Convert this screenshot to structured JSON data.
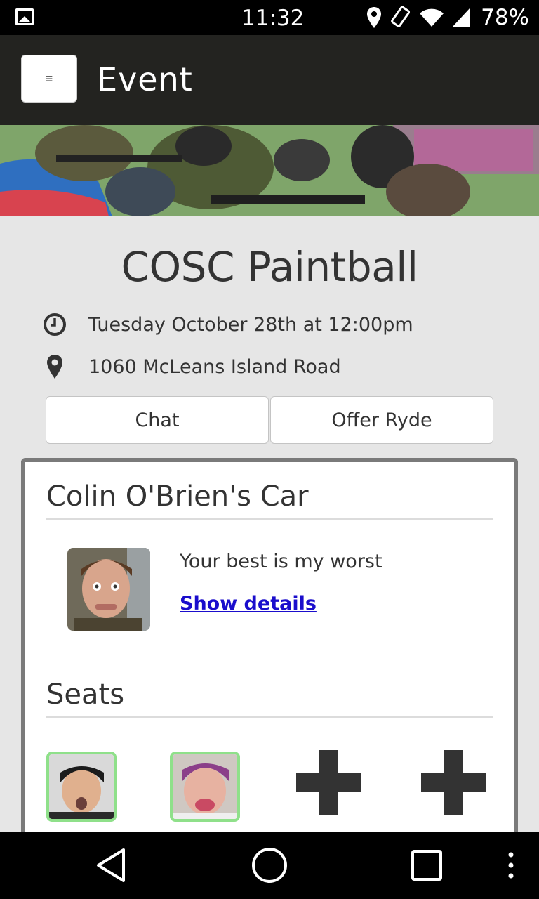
{
  "status_bar": {
    "time": "11:32",
    "battery": "78%",
    "icons": [
      "image-icon",
      "location-icon",
      "rotate-icon",
      "wifi-icon",
      "signal-icon"
    ]
  },
  "app_bar": {
    "menu_glyph": "≡",
    "title": "Event"
  },
  "event": {
    "name": "COSC Paintball",
    "datetime": "Tuesday October 28th at 12:00pm",
    "location": "1060 McLeans Island Road"
  },
  "actions": {
    "chat_label": "Chat",
    "offer_label": "Offer Ryde"
  },
  "car_card": {
    "title": "Colin O'Brien's Car",
    "quote": "Your best is my worst",
    "details_link": "Show details",
    "seats_title": "Seats"
  },
  "colors": {
    "app_bar": "#232320",
    "background": "#e6e6e6",
    "link": "#1a0dcc",
    "seat_border": "#8fe08a"
  }
}
